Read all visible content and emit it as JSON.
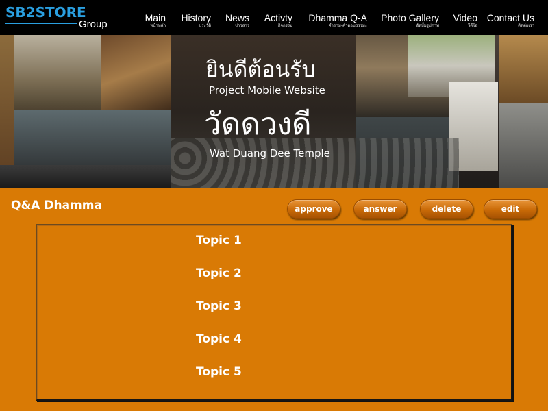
{
  "brand": {
    "name": "SB2STORE",
    "suffix": "Group",
    "accent_color": "#2a9fe0"
  },
  "nav": {
    "items": [
      {
        "label": "Main",
        "sub": "หน้าหลัก"
      },
      {
        "label": "History",
        "sub": "ประวัติ"
      },
      {
        "label": "News",
        "sub": "ข่าวสาร"
      },
      {
        "label": "Activty",
        "sub": "กิจกรรม"
      },
      {
        "label": "Dhamma Q-A",
        "sub": "คำถาม-คำตอบธรรมะ"
      },
      {
        "label": "Photo Gallery",
        "sub": "อัลบั้มรูปภาพ"
      },
      {
        "label": "Video",
        "sub": "วีดีโอ"
      },
      {
        "label": "Contact Us",
        "sub": "ติดต่อเรา"
      }
    ]
  },
  "hero": {
    "welcome_thai": "ยินดีต้อนรับ",
    "welcome_eng": "Project Mobile Website",
    "temple_thai": "วัดดวงดี",
    "temple_eng": "Wat Duang Dee Temple"
  },
  "page": {
    "title": "Q&A Dhamma",
    "background_color": "#d97a05"
  },
  "actions": {
    "approve": "approve",
    "answer": "answer",
    "delete": "delete",
    "edit": "edit"
  },
  "topics": [
    "Topic 1",
    "Topic 2",
    "Topic 3",
    "Topic 4",
    "Topic 5"
  ]
}
